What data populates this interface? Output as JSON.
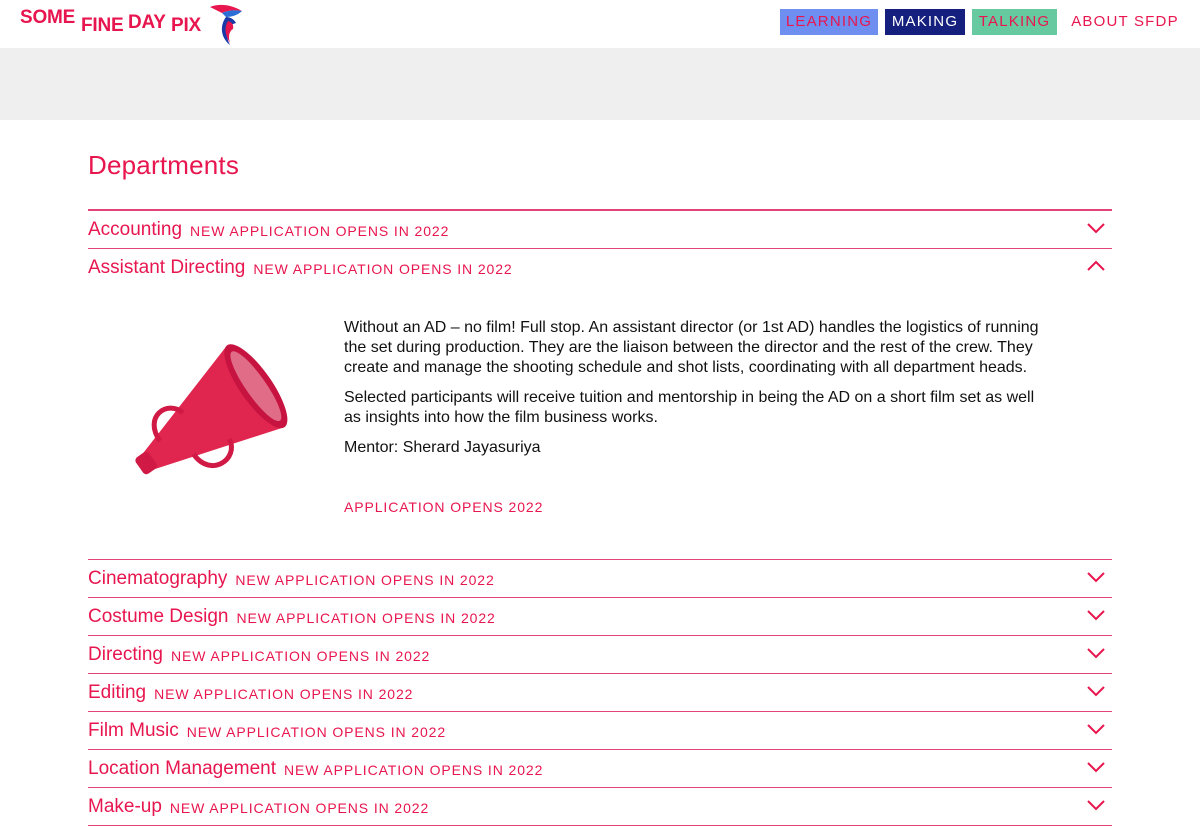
{
  "header": {
    "logo": {
      "word1": "SOME",
      "word2": "FINE",
      "word3": "DAY",
      "word4": "PIX",
      "icon": "swallow-bird-icon"
    },
    "nav": [
      {
        "label": "LEARNING",
        "bg": "#6e8ef0",
        "color": "#e8164f"
      },
      {
        "label": "MAKING",
        "bg": "#141f7e",
        "color": "#ffffff"
      },
      {
        "label": "TALKING",
        "bg": "#66c9a0",
        "color": "#e8164f"
      },
      {
        "label": "ABOUT SFDP",
        "bg": "transparent",
        "color": "#e8164f"
      }
    ]
  },
  "page": {
    "title": "Departments"
  },
  "departments": [
    {
      "name": "Accounting",
      "status": "NEW APPLICATION OPENS IN 2022",
      "expanded": false
    },
    {
      "name": "Assistant Directing",
      "status": "NEW APPLICATION OPENS IN 2022",
      "expanded": true,
      "paragraphs": [
        "Without an AD – no film! Full stop. An assistant director (or 1st AD) handles the logistics of running the set during production. They are the liaison between the director and the rest of the crew. They create and manage the shooting schedule and shot lists, coordinating with all department heads.",
        "Selected participants will receive tuition and mentorship in being the AD on a short film set as well as insights into how the film business works.",
        "Mentor: Sherard Jayasuriya"
      ],
      "link": "APPLICATION OPENS 2022",
      "image_icon": "megaphone-icon"
    },
    {
      "name": "Cinematography",
      "status": "NEW APPLICATION OPENS IN 2022",
      "expanded": false
    },
    {
      "name": "Costume Design",
      "status": "NEW APPLICATION OPENS IN 2022",
      "expanded": false
    },
    {
      "name": "Directing",
      "status": "NEW APPLICATION OPENS IN 2022",
      "expanded": false
    },
    {
      "name": "Editing",
      "status": "NEW APPLICATION OPENS IN 2022",
      "expanded": false
    },
    {
      "name": "Film Music",
      "status": "NEW APPLICATION OPENS IN 2022",
      "expanded": false
    },
    {
      "name": "Location Management",
      "status": "NEW APPLICATION OPENS IN 2022",
      "expanded": false
    },
    {
      "name": "Make-up",
      "status": "NEW APPLICATION OPENS IN 2022",
      "expanded": false
    }
  ],
  "colors": {
    "accent": "#e8164f",
    "rule": "#e24478",
    "banner": "#efefef"
  }
}
